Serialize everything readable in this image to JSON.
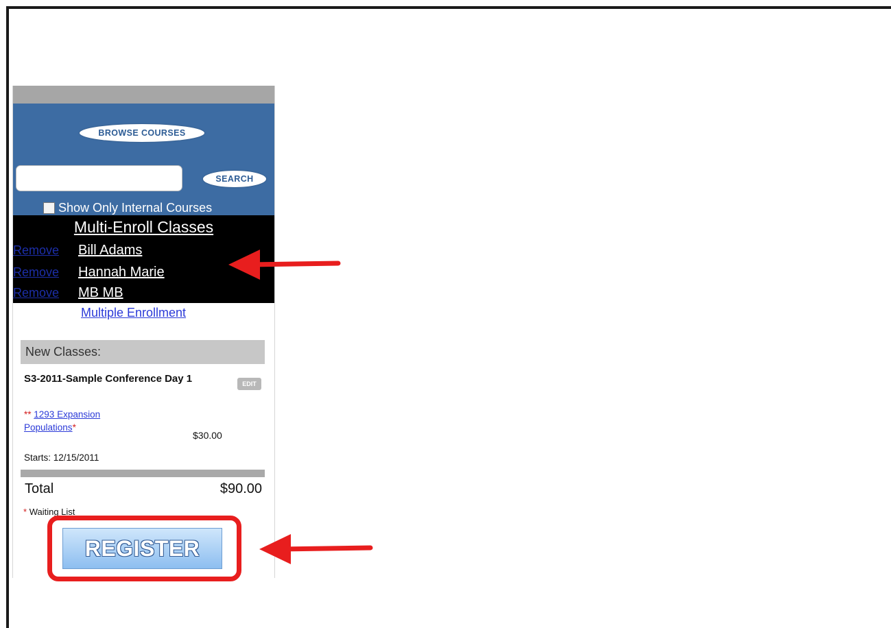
{
  "sidebar": {
    "browse_label": "BROWSE COURSES",
    "search_label": "SEARCH",
    "search_value": "",
    "checkbox_label": "Show Only Internal Courses"
  },
  "multi_enroll": {
    "title": "Multi-Enroll Classes",
    "people": [
      {
        "remove": "Remove",
        "name": "Bill Adams"
      },
      {
        "remove": "Remove",
        "name": "Hannah Marie"
      },
      {
        "remove": "Remove",
        "name": "MB MB"
      }
    ],
    "link": "Multiple Enrollment"
  },
  "cart": {
    "header": "New Classes:",
    "course_title": "S3-2011-Sample Conference Day 1",
    "edit_label": "EDIT",
    "session_marker": "**",
    "session_link": "1293 Expansion Populations",
    "session_suffix": "*",
    "price": "$30.00",
    "starts": "Starts: 12/15/2011",
    "total_label": "Total",
    "total_value": "$90.00",
    "waiting_marker": "*",
    "waiting_text": "Waiting List",
    "register_label": "REGISTER"
  },
  "colors": {
    "panel_blue": "#3d6ca3",
    "arrow_red": "#e81e1e",
    "link_blue": "#2b3ad8"
  }
}
